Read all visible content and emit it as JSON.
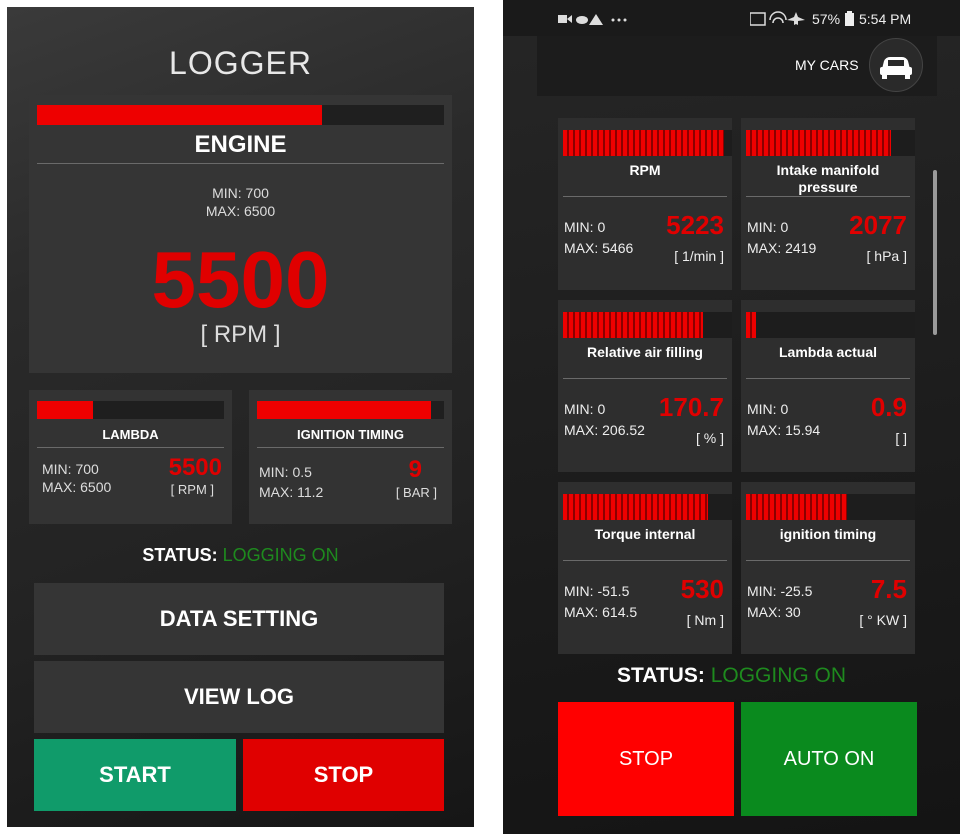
{
  "logger": {
    "title": "LOGGER",
    "engine": {
      "label": "ENGINE",
      "min": "MIN: 700",
      "max": "MAX: 6500",
      "value": "5500",
      "unit": "[ RPM ]",
      "level": 0.7
    },
    "lambda": {
      "label": "LAMBDA",
      "min": "MIN: 700",
      "max": "MAX: 6500",
      "value": "5500",
      "unit": "[ RPM ]",
      "level": 0.3
    },
    "ignition": {
      "label": "IGNITION TIMING",
      "min": "MIN: 0.5",
      "max": "MAX: 11.2",
      "value": "9",
      "unit": "[ BAR ]",
      "level": 0.93
    },
    "status_label": "STATUS:",
    "status_value": "LOGGING ON",
    "data_setting": "DATA SETTING",
    "view_log": "VIEW LOG",
    "start": "START",
    "stop": "STOP"
  },
  "app": {
    "statusbar": {
      "battery": "57%",
      "time": "5:54 PM"
    },
    "my_cars": "MY CARS",
    "cards": [
      {
        "title": "RPM",
        "min": "MIN: 0",
        "max": "MAX: 5466",
        "value": "5223",
        "unit": "[ 1/min ]",
        "level": 0.95
      },
      {
        "title": "Intake manifold pressure",
        "min": "MIN: 0",
        "max": "MAX: 2419",
        "value": "2077",
        "unit": "[ hPa ]",
        "level": 0.86
      },
      {
        "title": "Relative air filling",
        "min": "MIN: 0",
        "max": "MAX: 206.52",
        "value": "170.7",
        "unit": "[ % ]",
        "level": 0.83
      },
      {
        "title": "Lambda actual",
        "min": "MIN: 0",
        "max": "MAX: 15.94",
        "value": "0.9",
        "unit": "[ ]",
        "level": 0.06
      },
      {
        "title": "Torque internal",
        "min": "MIN: -51.5",
        "max": "MAX: 614.5",
        "value": "530",
        "unit": "[ Nm ]",
        "level": 0.86
      },
      {
        "title": "ignition timing",
        "min": "MIN: -25.5",
        "max": "MAX: 30",
        "value": "7.5",
        "unit": "[ ° KW ]",
        "level": 0.6
      }
    ],
    "status_label": "STATUS:",
    "status_value": "LOGGING ON",
    "stop": "STOP",
    "auto_on": "AUTO ON"
  },
  "colors": {
    "red": "#e00000",
    "green_button": "#109b6a",
    "green_status": "#1e8a1e",
    "auto_green": "#0a8a1e",
    "stop_red": "#ff0000"
  }
}
